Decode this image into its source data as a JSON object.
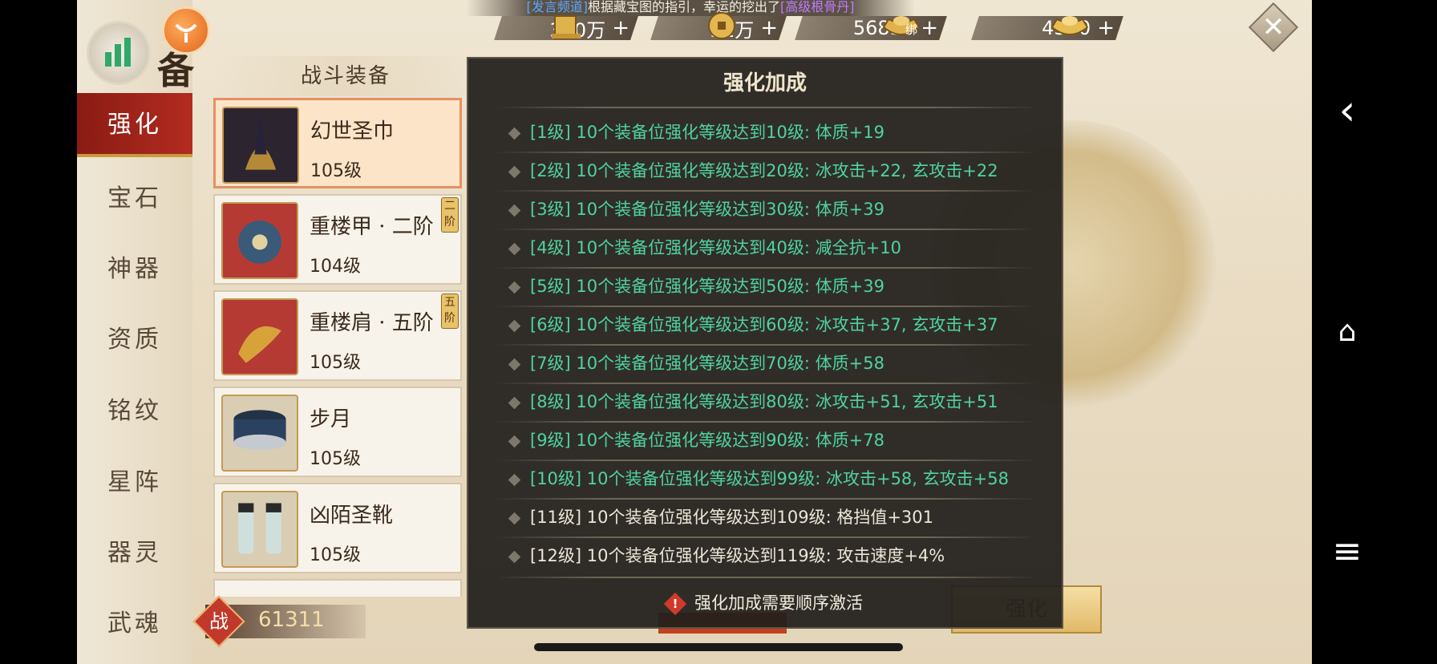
{
  "banner": {
    "prefix": "[发言频道]",
    "text": "根据藏宝图的指引，幸运的挖出了",
    "item": "[高级根骨丹]"
  },
  "currencies": [
    {
      "icon": "gold-bar-icon",
      "value": "340万"
    },
    {
      "icon": "coin-icon",
      "value": "51万"
    },
    {
      "icon": "bound-ingot-icon",
      "badge": "绑",
      "value": "56836"
    },
    {
      "icon": "ingot-icon",
      "value": "4350"
    }
  ],
  "plus_label": "+",
  "close_label": "✕",
  "page_title_char": "备",
  "sidebar": {
    "items": [
      {
        "label": "强化",
        "active": true
      },
      {
        "label": "宝石"
      },
      {
        "label": "神器"
      },
      {
        "label": "资质"
      },
      {
        "label": "铭纹"
      },
      {
        "label": "星阵"
      },
      {
        "label": "器灵"
      },
      {
        "label": "武魂"
      }
    ]
  },
  "equip_panel": {
    "header": "战斗装备",
    "items": [
      {
        "name": "幻世圣巾",
        "level": "105级",
        "tier": ""
      },
      {
        "name": "重楼甲 · 二阶",
        "level": "104级",
        "tier": "二阶"
      },
      {
        "name": "重楼肩 · 五阶",
        "level": "105级",
        "tier": "五阶"
      },
      {
        "name": "步月",
        "level": "105级",
        "tier": ""
      },
      {
        "name": "凶陌圣靴",
        "level": "105级",
        "tier": ""
      }
    ]
  },
  "combat_power": {
    "label": "战",
    "value": "61311"
  },
  "enhance_button": "强化",
  "popup": {
    "title": "强化加成",
    "rows": [
      {
        "text": "[1级] 10个装备位强化等级达到10级:  体质+19",
        "active": true
      },
      {
        "text": "[2级] 10个装备位强化等级达到20级:  冰攻击+22, 玄攻击+22",
        "active": true
      },
      {
        "text": "[3级] 10个装备位强化等级达到30级:  体质+39",
        "active": true
      },
      {
        "text": "[4级] 10个装备位强化等级达到40级:  减全抗+10",
        "active": true
      },
      {
        "text": "[5级] 10个装备位强化等级达到50级:  体质+39",
        "active": true
      },
      {
        "text": "[6级] 10个装备位强化等级达到60级:  冰攻击+37, 玄攻击+37",
        "active": true
      },
      {
        "text": "[7级] 10个装备位强化等级达到70级:  体质+58",
        "active": true
      },
      {
        "text": "[8级] 10个装备位强化等级达到80级:  冰攻击+51, 玄攻击+51",
        "active": true
      },
      {
        "text": "[9级] 10个装备位强化等级达到90级:  体质+78",
        "active": true
      },
      {
        "text": "[10级] 10个装备位强化等级达到99级:  冰攻击+58, 玄攻击+58",
        "active": true
      },
      {
        "text": "[11级] 10个装备位强化等级达到109级:  格挡值+301",
        "active": false
      },
      {
        "text": "[12级] 10个装备位强化等级达到119级:  攻击速度+4%",
        "active": false
      }
    ],
    "note": "强化加成需要顺序激活",
    "warn_symbol": "!"
  },
  "system_nav": {
    "back": "‹",
    "home": "⌂",
    "menu": "≡"
  }
}
